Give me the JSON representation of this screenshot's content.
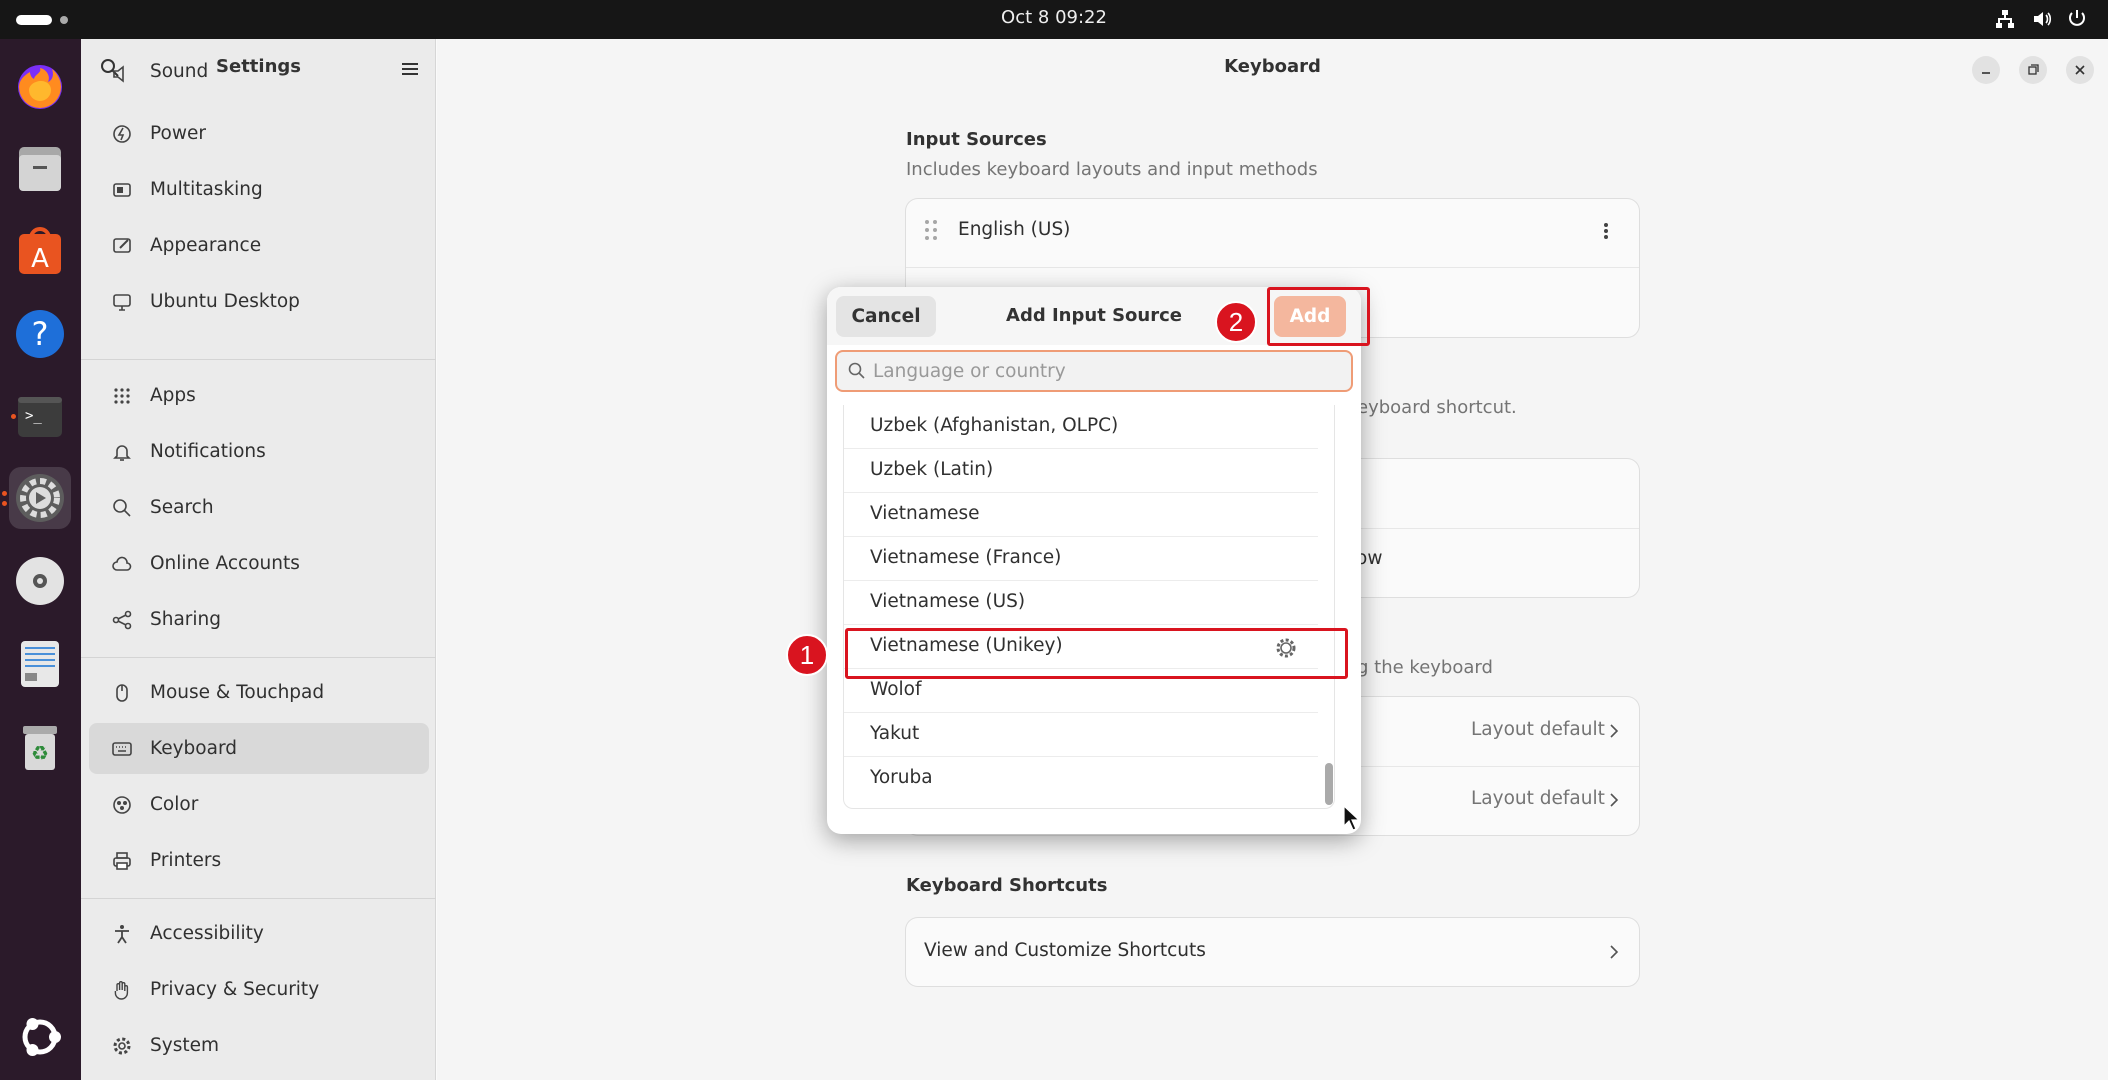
{
  "topbar": {
    "clock": "Oct 8  09:22"
  },
  "dock": {
    "items": [
      {
        "name": "firefox"
      },
      {
        "name": "files"
      },
      {
        "name": "app-center"
      },
      {
        "name": "help"
      },
      {
        "name": "terminal"
      },
      {
        "name": "settings"
      },
      {
        "name": "disc"
      },
      {
        "name": "text-editor"
      },
      {
        "name": "trash"
      },
      {
        "name": "show-apps"
      }
    ]
  },
  "sidebar": {
    "title": "Settings",
    "items": [
      {
        "label": "Sound",
        "icon": "speaker-icon"
      },
      {
        "label": "Power",
        "icon": "power-icon"
      },
      {
        "label": "Multitasking",
        "icon": "multitasking-icon"
      },
      {
        "label": "Appearance",
        "icon": "appearance-icon"
      },
      {
        "label": "Ubuntu Desktop",
        "icon": "desktop-icon"
      },
      {
        "label": "Apps",
        "icon": "apps-grid-icon"
      },
      {
        "label": "Notifications",
        "icon": "bell-icon"
      },
      {
        "label": "Search",
        "icon": "search-icon"
      },
      {
        "label": "Online Accounts",
        "icon": "cloud-icon"
      },
      {
        "label": "Sharing",
        "icon": "share-icon"
      },
      {
        "label": "Mouse & Touchpad",
        "icon": "mouse-icon"
      },
      {
        "label": "Keyboard",
        "icon": "keyboard-icon"
      },
      {
        "label": "Color",
        "icon": "color-icon"
      },
      {
        "label": "Printers",
        "icon": "printer-icon"
      },
      {
        "label": "Accessibility",
        "icon": "accessibility-icon"
      },
      {
        "label": "Privacy & Security",
        "icon": "hand-icon"
      },
      {
        "label": "System",
        "icon": "gear-icon"
      }
    ],
    "selected": "Keyboard"
  },
  "main": {
    "title": "Keyboard",
    "input_sources": {
      "title": "Input Sources",
      "subtitle": "Includes keyboard layouts and input methods",
      "items": [
        "English (US)"
      ]
    },
    "partial": {
      "shortcut_hint": "eyboard shortcut.",
      "row_fragment": "ow",
      "keyboard_hint": "g the keyboard"
    },
    "special_rows": [
      {
        "value": "Layout default"
      },
      {
        "value": "Layout default"
      }
    ],
    "shortcuts": {
      "title": "Keyboard Shortcuts",
      "row": "View and Customize Shortcuts"
    }
  },
  "dialog": {
    "title": "Add Input Source",
    "cancel_label": "Cancel",
    "add_label": "Add",
    "search_placeholder": "Language or country",
    "search_value": "",
    "items": [
      {
        "label": "Uzbek (Afghanistan, OLPC)"
      },
      {
        "label": "Uzbek (Latin)"
      },
      {
        "label": "Vietnamese"
      },
      {
        "label": "Vietnamese (France)"
      },
      {
        "label": "Vietnamese (US)"
      },
      {
        "label": "Vietnamese (Unikey)",
        "has_settings": true
      },
      {
        "label": "Wolof"
      },
      {
        "label": "Yakut"
      },
      {
        "label": "Yoruba"
      }
    ]
  },
  "annotations": {
    "badge_1": "1",
    "badge_2": "2",
    "color": "#d9141f"
  },
  "colors": {
    "accent": "#e95420",
    "add_button": "#f4b79e",
    "dock_bg": "#2b1a2a",
    "topbar_bg": "#161616"
  }
}
